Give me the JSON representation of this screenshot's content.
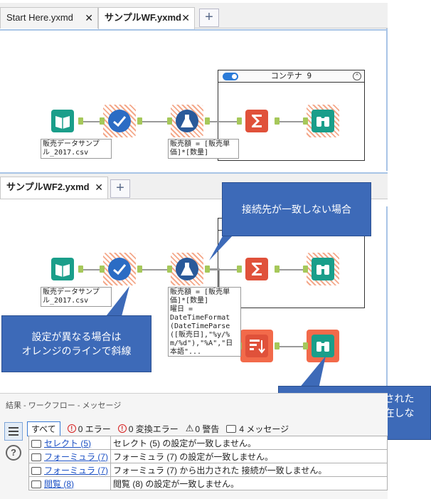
{
  "workflow1": {
    "tabs": [
      {
        "label": "Start Here.yxmd",
        "close": "✕"
      },
      {
        "label": "サンプルWF.yxmd",
        "close": "✕"
      }
    ],
    "add_tab": "+",
    "input_annotation": "販売データサンプ\nル_2017.csv",
    "formula_annotation": "販売額 = [販売単\n価]*[数量]",
    "container_title": "コンテナ 9",
    "container_collapse": "⌃"
  },
  "workflow2": {
    "tabs": [
      {
        "label": "サンプルWF2.yxmd",
        "close": "✕"
      }
    ],
    "add_tab": "+",
    "input_annotation": "販売データサンプ\nル_2017.csv",
    "formula_annotation": "販売額 = [販売単\n価]*[数量]\n曜日 =\nDateTimeFormat\n(DateTimeParse\n([販売日],\"%y/%\nm/%d\"),\"%A\",\"日\n本語\"..."
  },
  "callouts": {
    "mismatch_connection": "接続先が一致しない場合",
    "orange_hatch": "設定が異なる場合は\nオレンジのラインで斜線",
    "dark_orange": "濃いオレンジは追加された\nツール（相手側に存在しな\nいツール）"
  },
  "results": {
    "title": "結果 - ワークフロー - メッセージ",
    "filters": {
      "all": "すべて",
      "errors": "0 エラー",
      "conversion_errors": "0 変換エラー",
      "warnings": "0 警告",
      "messages": "4 メッセージ"
    },
    "rows": [
      {
        "link": "セレクト (5)",
        "message": "セレクト (5) の設定が一致しません。"
      },
      {
        "link": "フォーミュラ (7)",
        "message": "フォーミュラ (7) の設定が一致しません。"
      },
      {
        "link": "フォーミュラ (7)",
        "message": "フォーミュラ (7) から出力された 接続が一致しません。"
      },
      {
        "link": "閲覧 (8)",
        "message": "閲覧 (8) の設定が一致しません。"
      }
    ]
  },
  "colors": {
    "input_tool": "#1a9e8a",
    "select_tool": "#2b6cc4",
    "formula_tool": "#2a5a9a",
    "summarize_tool": "#e0513a",
    "browse_tool": "#1a9e8a",
    "added_tool_bg": "#f26a4a",
    "callout": "#3d6ab8"
  }
}
